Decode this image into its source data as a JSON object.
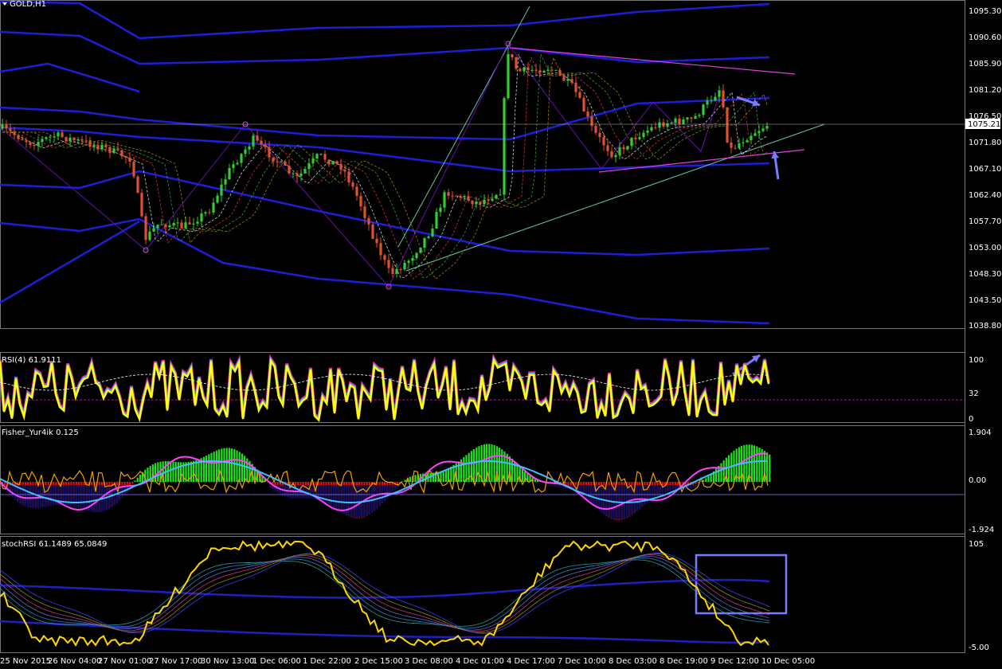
{
  "window": {
    "title": "GOLD,H1"
  },
  "price_axis": {
    "ticks": [
      "1095.30",
      "1090.60",
      "1085.90",
      "1081.20",
      "1076.50",
      "1071.80",
      "1067.10",
      "1062.40",
      "1057.70",
      "1053.00",
      "1048.30",
      "1043.50",
      "1038.80"
    ],
    "current_price": "1075.21"
  },
  "panels": {
    "rsi": {
      "label": "RSI(4) 61.9111",
      "scale": [
        "100",
        "32",
        "0"
      ],
      "level_value": 32
    },
    "fisher": {
      "label": "Fisher_Yur4ik 0.125",
      "scale": [
        "1.904",
        "0.00",
        "-1.924"
      ]
    },
    "stochrsi": {
      "label": "stochRSI 61.1489 65.0849",
      "scale": [
        "105",
        "-5.00"
      ]
    }
  },
  "time_axis": [
    "25 Nov 2015",
    "26 Nov 04:00",
    "27 Nov 01:00",
    "27 Nov 17:00",
    "30 Nov 13:00",
    "1 Dec 06:00",
    "1 Dec 22:00",
    "2 Dec 15:00",
    "3 Dec 08:00",
    "4 Dec 01:00",
    "4 Dec 17:00",
    "7 Dec 10:00",
    "8 Dec 03:00",
    "8 Dec 19:00",
    "9 Dec 12:00",
    "10 Dec 05:00"
  ],
  "colors": {
    "background": "#000000",
    "bull_candle": "#32cd32",
    "bear_candle": "#e0522c",
    "envelope": "#1e1ed8",
    "trend_line": "#5ec7a6",
    "channel_line": "#e040e0",
    "zigzag": "#6a0dad",
    "annotation": "#7b7bff",
    "rsi_main": "#ffff00"
  },
  "annotations": [
    "down-arrow",
    "up-arrow",
    "rsi-up-arrow",
    "stoch-highlight-box"
  ]
}
